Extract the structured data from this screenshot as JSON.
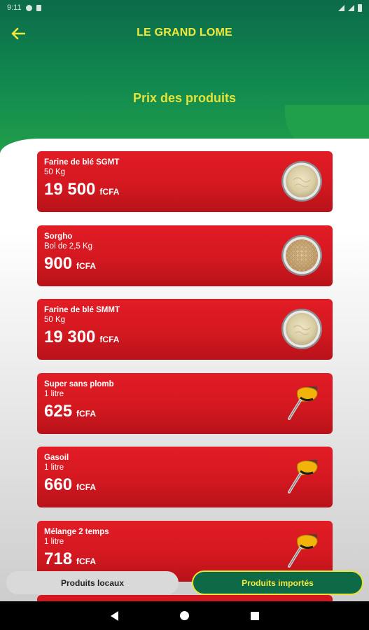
{
  "status_bar": {
    "time": "9:11",
    "icons": [
      "settings-icon",
      "sd-card-icon",
      "wifi-icon",
      "signal-icon",
      "battery-icon"
    ]
  },
  "header": {
    "back_icon": "arrow-left-icon",
    "title": "LE GRAND LOME",
    "subtitle": "Prix des produits"
  },
  "products": [
    {
      "name": "Farine de blé SGMT",
      "unit": "50 Kg",
      "price": "19 500",
      "currency": "fCFA",
      "image": "flour-bowl"
    },
    {
      "name": "Sorgho",
      "unit": "Bol de 2,5 Kg",
      "price": "900",
      "currency": "fCFA",
      "image": "sorghum-bowl"
    },
    {
      "name": "Farine de blé SMMT",
      "unit": "50 Kg",
      "price": "19 300",
      "currency": "fCFA",
      "image": "flour-bowl"
    },
    {
      "name": "Super sans plomb",
      "unit": "1 litre",
      "price": "625",
      "currency": "fCFA",
      "image": "fuel-nozzle"
    },
    {
      "name": "Gasoil",
      "unit": "1 litre",
      "price": "660",
      "currency": "fCFA",
      "image": "fuel-nozzle"
    },
    {
      "name": "Mélange 2 temps",
      "unit": "1 litre",
      "price": "718",
      "currency": "fCFA",
      "image": "fuel-nozzle"
    }
  ],
  "tabs": {
    "local": "Produits locaux",
    "imported": "Produits importés",
    "active": "imported"
  },
  "colors": {
    "header_green": "#0b6b4a",
    "accent_yellow": "#f2e93c",
    "card_red": "#d41820"
  },
  "nav_bar": {
    "icons": [
      "back-triangle-icon",
      "home-circle-icon",
      "recents-square-icon"
    ]
  }
}
